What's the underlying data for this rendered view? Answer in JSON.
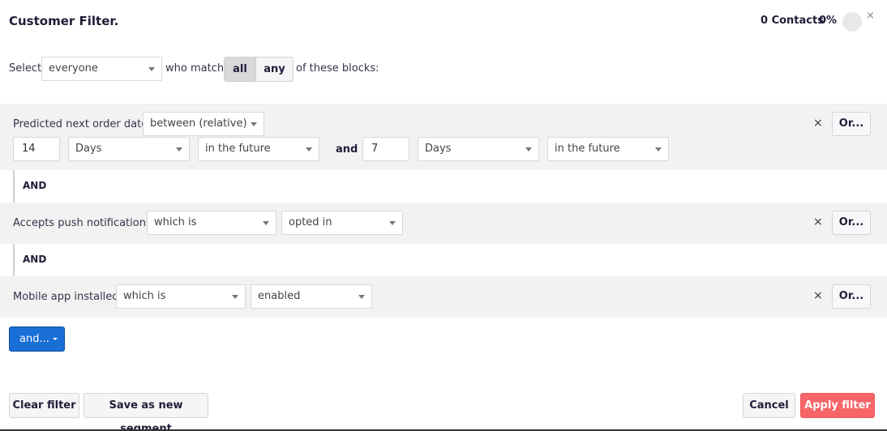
{
  "header": {
    "title": "Customer Filter.",
    "contacts": "0 Contacts",
    "percent": "0%",
    "close_icon": "×"
  },
  "selector": {
    "select_label": "Select",
    "audience": "everyone",
    "who_match_label": "who match",
    "match_options": [
      "all",
      "any"
    ],
    "match_selected": "all",
    "suffix_label": "of these blocks:"
  },
  "blocks": [
    {
      "field": "Predicted next order date",
      "operator": "between (relative)",
      "from_value": "14",
      "from_unit": "Days",
      "from_direction": "in the future",
      "and_word": "and",
      "to_value": "7",
      "to_unit": "Days",
      "to_direction": "in the future",
      "remove_icon": "×",
      "or_label": "Or..."
    },
    {
      "field": "Accepts push notifications",
      "operator": "which is",
      "value": "opted in",
      "remove_icon": "×",
      "or_label": "Or..."
    },
    {
      "field": "Mobile app installed",
      "operator": "which is",
      "value": "enabled",
      "remove_icon": "×",
      "or_label": "Or..."
    }
  ],
  "connectors": [
    "AND",
    "AND"
  ],
  "add_block_button": "and...",
  "footer": {
    "clear_filter": "Clear filter",
    "save_segment": "Save as new segment",
    "cancel": "Cancel",
    "apply": "Apply filter"
  },
  "colors": {
    "primary": "#1a6fd6",
    "apply": "#f76568",
    "block_bg": "#f2f2f2"
  }
}
